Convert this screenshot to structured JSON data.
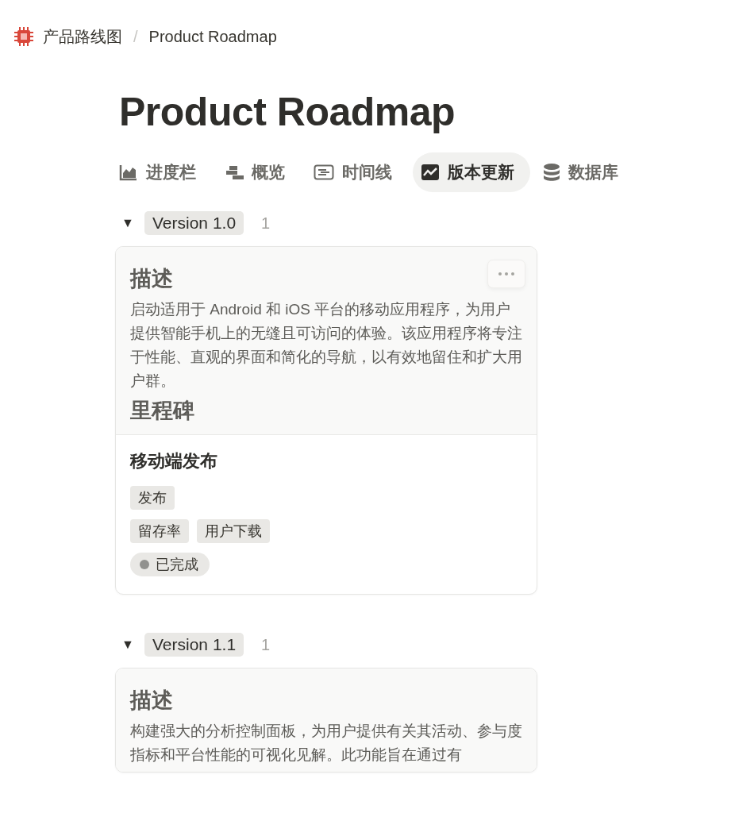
{
  "breadcrumb": {
    "workspace": "产品路线图",
    "separator": "/",
    "page": "Product Roadmap"
  },
  "title": "Product Roadmap",
  "tabs": [
    {
      "label": "进度栏",
      "kind": "area",
      "selected": false
    },
    {
      "label": "概览",
      "kind": "bars",
      "selected": false
    },
    {
      "label": "时间线",
      "kind": "timeline",
      "selected": false
    },
    {
      "label": "版本更新",
      "kind": "chart",
      "selected": true
    },
    {
      "label": "数据库",
      "kind": "database",
      "selected": false
    }
  ],
  "groups": [
    {
      "toggle": "▼",
      "expanded": true,
      "label": "Version 1.0",
      "count": "1",
      "cards": [
        {
          "hovered": true,
          "sections": [
            {
              "heading": "描述",
              "text": "启动适用于 Android 和 iOS 平台的移动应用程序，为用户提供智能手机上的无缝且可访问的体验。该应用程序将专注于性能、直观的界面和简化的导航，以有效地留住和扩大用户群。"
            },
            {
              "heading": "里程碑"
            }
          ],
          "title": "移动端发布",
          "tag_rows": [
            [
              "发布"
            ],
            [
              "留存率",
              "用户下载"
            ]
          ],
          "status": {
            "label": "已完成",
            "color": "#91918e"
          }
        }
      ]
    },
    {
      "toggle": "▼",
      "expanded": true,
      "label": "Version 1.1",
      "count": "1",
      "cards": [
        {
          "hovered": false,
          "sections": [
            {
              "heading": "描述",
              "text": "构建强大的分析控制面板，为用户提供有关其活动、参与度指标和平台性能的可视化见解。此功能旨在通过有"
            }
          ]
        }
      ]
    }
  ]
}
